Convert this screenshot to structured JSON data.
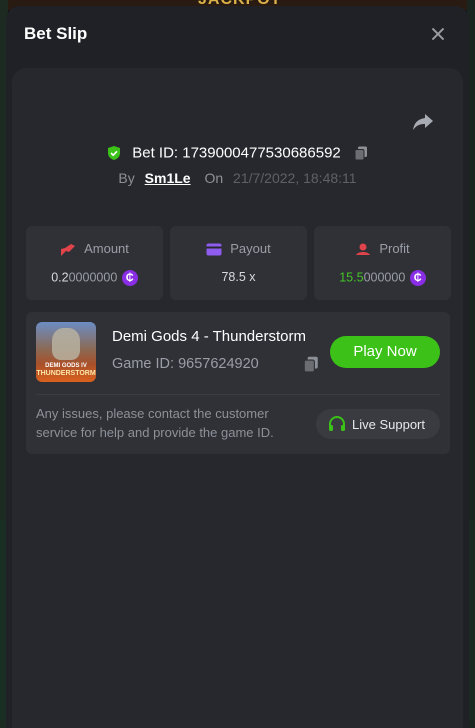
{
  "backdrop": {
    "banner_text": "JACKPOT"
  },
  "modal": {
    "title": "Bet Slip"
  },
  "bet": {
    "id_label": "Bet ID: 1739000477530686592",
    "by_label": "By",
    "user": "Sm1Le",
    "on_label": "On",
    "date": "21/7/2022, 18:48:11"
  },
  "stats": {
    "amount": {
      "label": "Amount",
      "value_hi": "0.2",
      "value_lo": "0000000"
    },
    "payout": {
      "label": "Payout",
      "value": "78.5 x"
    },
    "profit": {
      "label": "Profit",
      "value_hi": "15.5",
      "value_lo": "000000"
    },
    "coin_symbol": "₵"
  },
  "game": {
    "thumb_line1": "DEMI GODS IV",
    "thumb_line2": "THUNDERSTORM",
    "name": "Demi Gods 4 - Thunderstorm",
    "id_label": "Game ID: 9657624920",
    "play_label": "Play Now",
    "notice": "Any issues, please contact the customer service for help and provide the game ID.",
    "support_label": "Live Support"
  },
  "colors": {
    "accent_green": "#3bc117",
    "profit_green": "#45c325",
    "coin_purple": "#8a2ee6",
    "icon_red": "#e0444a",
    "payout_purple": "#8f5cf0"
  },
  "icons": [
    "close-icon",
    "share-icon",
    "shield-check-icon",
    "copy-icon",
    "amount-icon",
    "payout-icon",
    "profit-icon",
    "coin-icon",
    "headset-icon"
  ]
}
